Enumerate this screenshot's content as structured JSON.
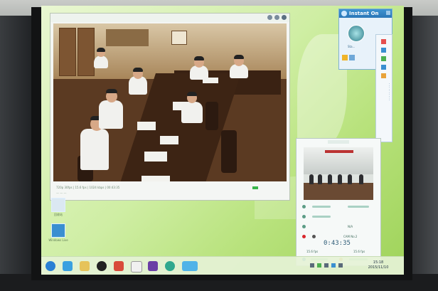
{
  "video_window": {
    "status_text": "720p 30fps  |  15.6 fps  |  1024 kbps  |  00:43:35"
  },
  "desktop": {
    "icons": [
      {
        "label": "回收站",
        "icon": "recycle-bin-icon"
      },
      {
        "label": "Windows Live",
        "icon": "app-icon"
      }
    ]
  },
  "im_panel": {
    "title": "Instant On",
    "status_line": "Sta...",
    "icon": "instant-on-icon"
  },
  "call_panel": {
    "controls": [
      {
        "icon": "microphone-icon",
        "value": ""
      },
      {
        "icon": "speaker-icon",
        "value": ""
      },
      {
        "icon": "camera-icon",
        "value": "N/A"
      },
      {
        "icon": "record-icon",
        "value": "CAM No.2"
      }
    ],
    "timer": "0:43:35",
    "bottom_left": "15.6 fps",
    "bottom_right": "15.6 fps",
    "status_color": "#d9262c"
  },
  "taskbar": {
    "time": "15:18",
    "date": "2015/11/10",
    "pinned_icons": [
      "start-button-icon",
      "ie-icon",
      "explorer-icon",
      "qq-icon",
      "player-icon",
      "media-icon",
      "app-icon",
      "network-icon",
      "video-conference-icon"
    ]
  },
  "colors": {
    "desktop_green": "#b8e27c",
    "im_header_blue": "#2b76b6"
  }
}
